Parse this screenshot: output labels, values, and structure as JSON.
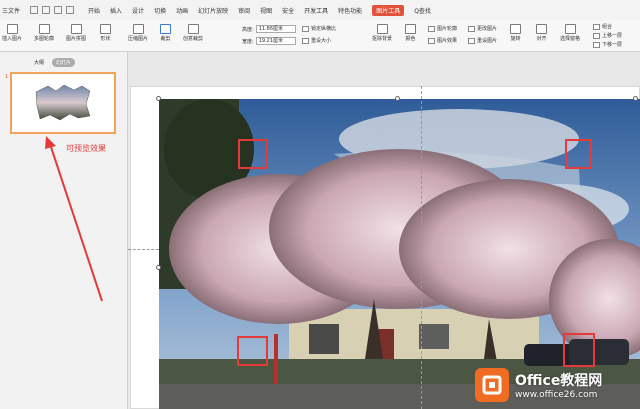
{
  "menubar": {
    "file_label": "三文件",
    "items": [
      "开始",
      "插入",
      "设计",
      "切换",
      "动画",
      "幻灯片放映",
      "审阅",
      "视图",
      "安全",
      "开发工具",
      "特色功能",
      "图片工具"
    ],
    "search_label": "Q查找"
  },
  "ribbon": {
    "insert_picture": "插入图片",
    "multi_outline": "多图轮廓",
    "multi_group": "图片拼图",
    "shape": "形状",
    "compress": "压缩图片",
    "crop": "裁剪",
    "create_tile": "创意裁剪",
    "height_label": "高度:",
    "height_value": "11.86厘米",
    "width_label": "宽度:",
    "width_value": "19.21厘米",
    "lock_ratio": "锁定纵横比",
    "reset_size": "重设大小",
    "remove_bg": "抠除背景",
    "color": "颜色",
    "picture_outline": "图片轮廓",
    "picture_effect": "图片效果",
    "change_picture": "更改图片",
    "reset_picture": "重设图片",
    "rotate": "旋转",
    "align": "对齐",
    "select_pane": "选择窗格",
    "group": "组合",
    "bring_forward": "上移一层",
    "send_backward": "下移一层"
  },
  "sidebar": {
    "tab_outline": "大纲",
    "tab_slides": "幻灯片",
    "slide_number": "1"
  },
  "annotation": "可预览效果",
  "watermark": {
    "title": "Office教程网",
    "url": "www.office26.com"
  },
  "colors": {
    "accent": "#e2533b",
    "annotation_red": "#e53a3a",
    "thumb_border": "#f2a35a",
    "logo_orange": "#f26b22"
  }
}
